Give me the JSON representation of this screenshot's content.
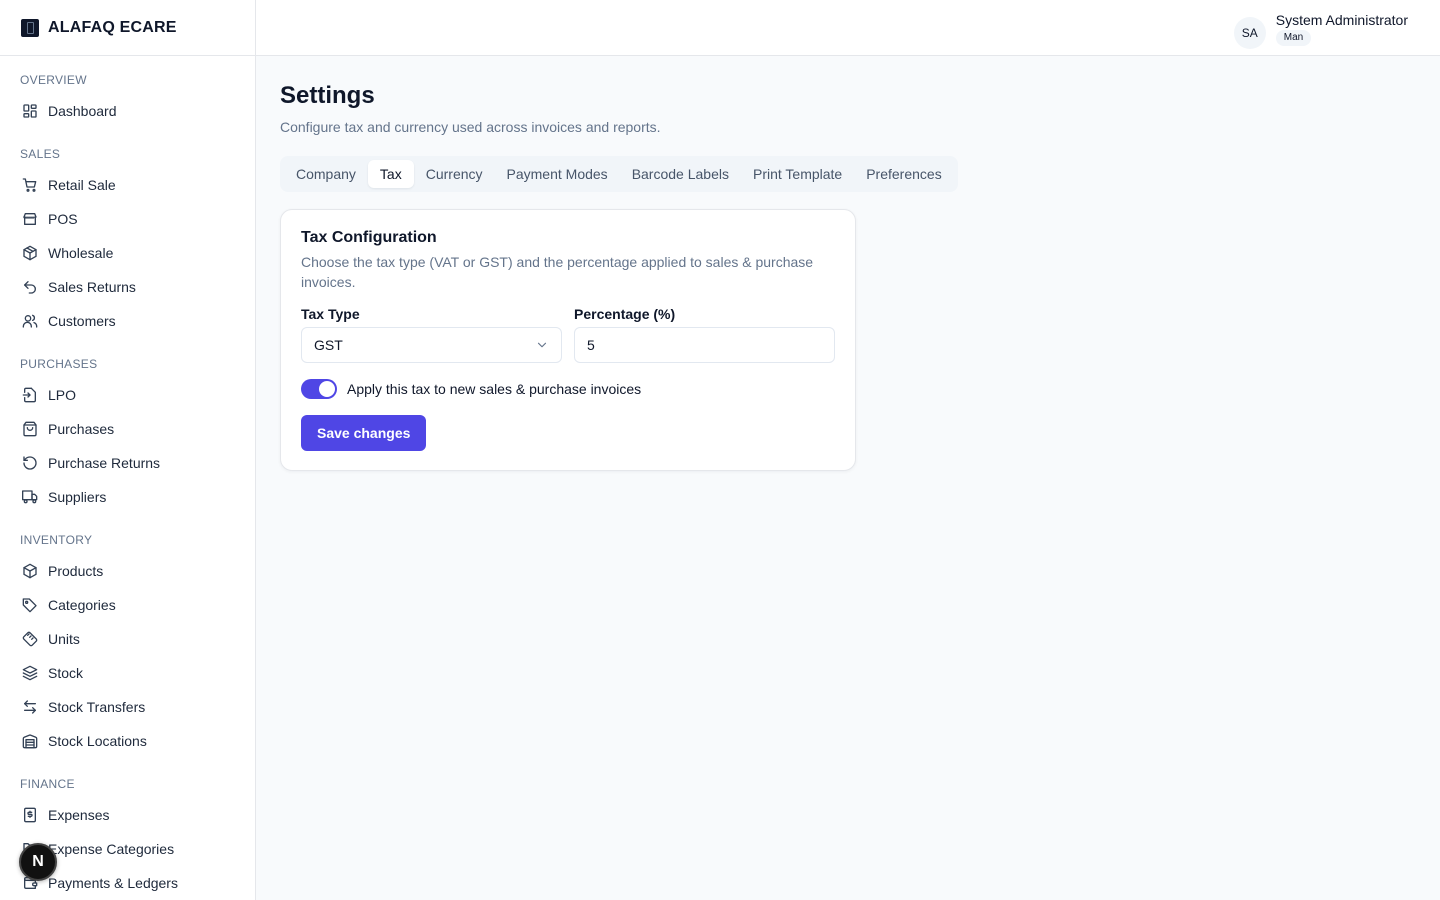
{
  "brand": {
    "name": "ALAFAQ ECARE"
  },
  "sidebar": {
    "sections": [
      {
        "label": "OVERVIEW",
        "items": [
          {
            "label": "Dashboard",
            "icon": "dashboard-icon"
          }
        ]
      },
      {
        "label": "SALES",
        "items": [
          {
            "label": "Retail Sale",
            "icon": "cart-icon"
          },
          {
            "label": "POS",
            "icon": "store-icon"
          },
          {
            "label": "Wholesale",
            "icon": "package-icon"
          },
          {
            "label": "Sales Returns",
            "icon": "undo-icon"
          },
          {
            "label": "Customers",
            "icon": "users-icon"
          }
        ]
      },
      {
        "label": "PURCHASES",
        "items": [
          {
            "label": "LPO",
            "icon": "file-arrow-icon"
          },
          {
            "label": "Purchases",
            "icon": "bag-icon"
          },
          {
            "label": "Purchase Returns",
            "icon": "rotate-icon"
          },
          {
            "label": "Suppliers",
            "icon": "truck-icon"
          }
        ]
      },
      {
        "label": "INVENTORY",
        "items": [
          {
            "label": "Products",
            "icon": "box-icon"
          },
          {
            "label": "Categories",
            "icon": "tag-icon"
          },
          {
            "label": "Units",
            "icon": "ruler-icon"
          },
          {
            "label": "Stock",
            "icon": "layers-icon"
          },
          {
            "label": "Stock Transfers",
            "icon": "transfer-icon"
          },
          {
            "label": "Stock Locations",
            "icon": "warehouse-icon"
          }
        ]
      },
      {
        "label": "FINANCE",
        "items": [
          {
            "label": "Expenses",
            "icon": "receipt-icon"
          },
          {
            "label": "Expense Categories",
            "icon": "folder-icon"
          },
          {
            "label": "Payments & Ledgers",
            "icon": "wallet-icon"
          }
        ]
      }
    ]
  },
  "user": {
    "initials": "SA",
    "name": "System Administrator",
    "role": "Man"
  },
  "page": {
    "title": "Settings",
    "subtitle": "Configure tax and currency used across invoices and reports."
  },
  "tabs": [
    {
      "label": "Company",
      "active": false
    },
    {
      "label": "Tax",
      "active": true
    },
    {
      "label": "Currency",
      "active": false
    },
    {
      "label": "Payment Modes",
      "active": false
    },
    {
      "label": "Barcode Labels",
      "active": false
    },
    {
      "label": "Print Template",
      "active": false
    },
    {
      "label": "Preferences",
      "active": false
    }
  ],
  "tax_card": {
    "title": "Tax Configuration",
    "description": "Choose the tax type (VAT or GST) and the percentage applied to sales & purchase invoices.",
    "tax_type_label": "Tax Type",
    "tax_type_value": "GST",
    "percentage_label": "Percentage (%)",
    "percentage_value": "5",
    "toggle_label": "Apply this tax to new sales & purchase invoices",
    "toggle_on": true,
    "save_label": "Save changes"
  },
  "dev_badge": {
    "label": "N"
  },
  "colors": {
    "accent": "#4f46e5"
  }
}
